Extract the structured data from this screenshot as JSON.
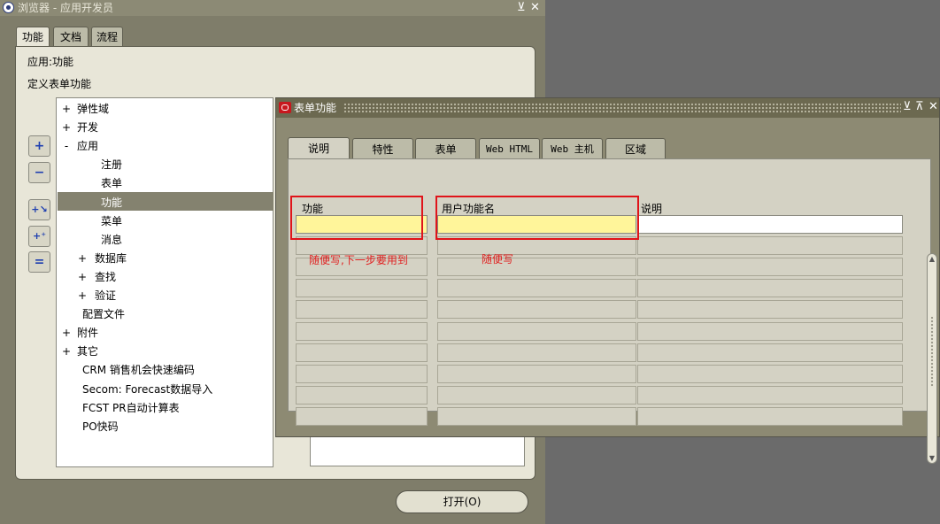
{
  "navigator": {
    "title": "浏览器 - 应用开发员",
    "title_controls": {
      "minimize": "⊻",
      "close": "✕"
    },
    "tabs": [
      "功能",
      "文档",
      "流程"
    ],
    "active_tab": "功能",
    "app_label": "应用:功能",
    "sub_label": "定义表单功能",
    "tree": [
      {
        "prefix": "+",
        "label": "弹性域"
      },
      {
        "prefix": "+",
        "label": "开发"
      },
      {
        "prefix": "-",
        "label": "应用"
      },
      {
        "prefix": "",
        "label": "注册"
      },
      {
        "prefix": "",
        "label": "表单"
      },
      {
        "prefix": "",
        "label": "功能",
        "selected": true
      },
      {
        "prefix": "",
        "label": "菜单"
      },
      {
        "prefix": "",
        "label": "消息"
      },
      {
        "prefix": "+",
        "label": "数据库"
      },
      {
        "prefix": "+",
        "label": "查找"
      },
      {
        "prefix": "+",
        "label": "验证"
      },
      {
        "prefix": "",
        "label": "配置文件"
      },
      {
        "prefix": "+",
        "label": "附件"
      },
      {
        "prefix": "+",
        "label": "其它"
      },
      {
        "prefix": "",
        "label": "CRM 销售机会快速编码"
      },
      {
        "prefix": "",
        "label": "Secom: Forecast数据导入"
      },
      {
        "prefix": "",
        "label": "FCST PR自动计算表"
      },
      {
        "prefix": "",
        "label": "PO快码"
      }
    ],
    "open_button": "打开(O)"
  },
  "form_window": {
    "title": "表单功能",
    "title_controls": {
      "minimize": "⊻",
      "maximize": "⊼",
      "close": "✕"
    },
    "tabs": [
      "说明",
      "特性",
      "表单",
      "Web HTML",
      "Web 主机",
      "区域"
    ],
    "active_tab": "说明",
    "columns": [
      "功能",
      "用户功能名",
      "说明"
    ],
    "annotations": {
      "function_note": "随便写,下一步要用到",
      "user_function_note": "随便写"
    },
    "row_count": 10
  },
  "colors": {
    "highlight_field": "#fff59a",
    "annotation_red": "#e0141a",
    "selection": "#84826f"
  }
}
